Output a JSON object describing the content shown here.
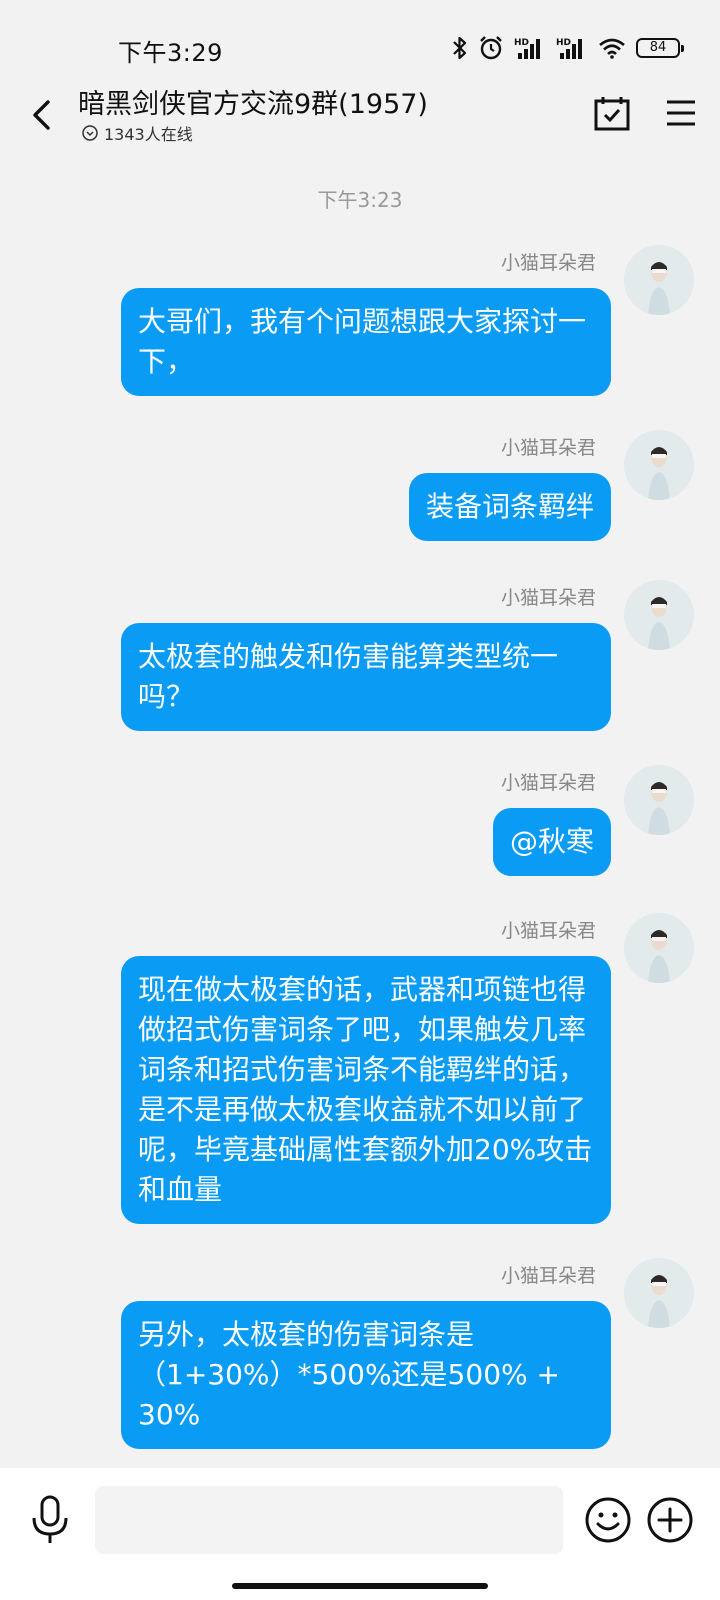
{
  "status_bar": {
    "time": "下午3:29",
    "battery": "84",
    "icons": [
      "bluetooth-icon",
      "alarm-icon",
      "hd-signal-icon",
      "hd-signal-icon",
      "wifi-icon",
      "battery-icon"
    ]
  },
  "header": {
    "title": "暗黑剑侠官方交流9群(1957)",
    "online_count": "1343人在线"
  },
  "chat": {
    "timestamp": "下午3:23",
    "messages": [
      {
        "sender": "小猫耳朵君",
        "text": "大哥们，我有个问题想跟大家探讨一下，"
      },
      {
        "sender": "小猫耳朵君",
        "text": "装备词条羁绊"
      },
      {
        "sender": "小猫耳朵君",
        "text": "太极套的触发和伤害能算类型统一吗？"
      },
      {
        "sender": "小猫耳朵君",
        "text": "@秋寒"
      },
      {
        "sender": "小猫耳朵君",
        "text": "现在做太极套的话，武器和项链也得做招式伤害词条了吧，如果触发几率词条和招式伤害词条不能羁绊的话，是不是再做太极套收益就不如以前了呢，毕竟基础属性套额外加20%攻击和血量"
      },
      {
        "sender": "小猫耳朵君",
        "text": "另外，太极套的伤害词条是（1+30%）*500%还是500% + 30%"
      }
    ]
  },
  "input_bar": {
    "placeholder": ""
  },
  "colors": {
    "bubble": "#0a9cf5",
    "background": "#f2f2f2"
  }
}
